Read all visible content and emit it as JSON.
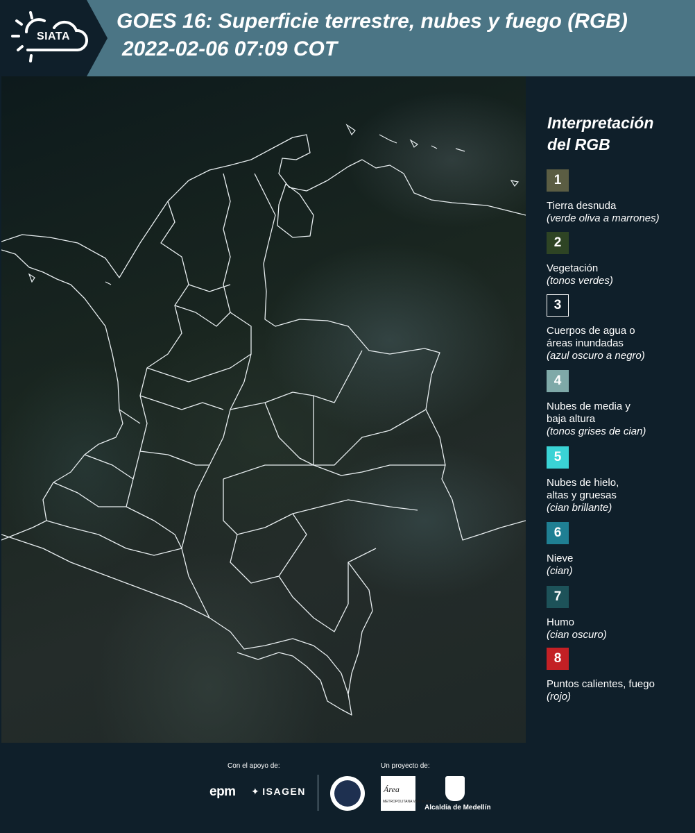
{
  "header": {
    "logo_text": "SIATA",
    "title_line1": "GOES 16: Superficie terrestre, nubes y fuego (RGB)",
    "title_line2": "2022-02-06 07:09 COT"
  },
  "legend": {
    "title_line1": "Interpretación",
    "title_line2": "del RGB",
    "items": [
      {
        "number": "1",
        "color": "#5b5d43",
        "label": "Tierra desnuda",
        "note": "(verde oliva a marrones)"
      },
      {
        "number": "2",
        "color": "#2e4424",
        "label": "Vegetación",
        "note": "(tonos verdes)"
      },
      {
        "number": "3",
        "color": "#0f1f2a",
        "label_line1": "Cuerpos de agua o",
        "label_line2": "áreas inundadas",
        "note": "(azul oscuro a negro)"
      },
      {
        "number": "4",
        "color": "#7fa9a8",
        "label_line1": "Nubes de media y",
        "label_line2": "baja altura",
        "note": "(tonos grises de cian)"
      },
      {
        "number": "5",
        "color": "#3ad3d5",
        "label_line1": "Nubes de hielo,",
        "label_line2": "altas y gruesas",
        "note": "(cian brillante)"
      },
      {
        "number": "6",
        "color": "#1f7f93",
        "label": "Nieve",
        "note": "(cian)"
      },
      {
        "number": "7",
        "color": "#1d5259",
        "label": "Humo",
        "note": "(cian oscuro)"
      },
      {
        "number": "8",
        "color": "#c32025",
        "label": "Puntos calientes, fuego",
        "note": "(rojo)"
      }
    ]
  },
  "footer": {
    "support_label": "Con el apoyo de:",
    "project_label": "Un proyecto de:",
    "sponsor_epm": "epm",
    "sponsor_isagen": "ISAGEN",
    "area_logo_text": "Área",
    "area_logo_sub": "METROPOLITANA Valle de Aburrá",
    "medellin_label": "Alcaldía de Medellín"
  }
}
